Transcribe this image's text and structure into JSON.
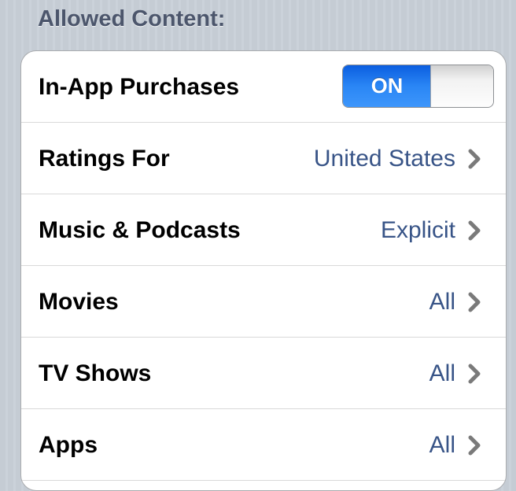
{
  "section": {
    "header": "Allowed Content:"
  },
  "rows": [
    {
      "label": "In-App Purchases",
      "toggle": {
        "state_label": "ON",
        "on": true
      }
    },
    {
      "label": "Ratings For",
      "value": "United States",
      "icon": "chevron-right-icon"
    },
    {
      "label": "Music & Podcasts",
      "value": "Explicit",
      "icon": "chevron-right-icon"
    },
    {
      "label": "Movies",
      "value": "All",
      "icon": "chevron-right-icon"
    },
    {
      "label": "TV Shows",
      "value": "All",
      "icon": "chevron-right-icon"
    },
    {
      "label": "Apps",
      "value": "All",
      "icon": "chevron-right-icon"
    }
  ],
  "colors": {
    "value_text": "#385487",
    "toggle_on": "#2a86f5",
    "header_text": "#4c566c"
  }
}
